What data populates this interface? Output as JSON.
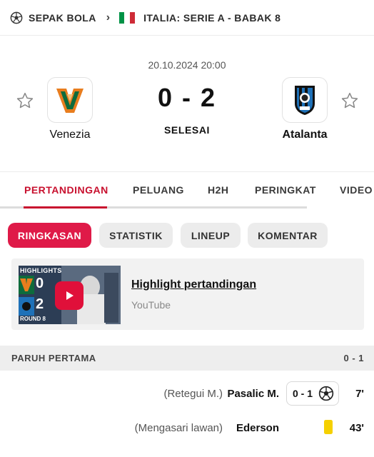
{
  "breadcrumb": {
    "sport": "SEPAK BOLA",
    "competition": "ITALIA: SERIE A - BABAK 8",
    "flag_colors": [
      "#009246",
      "#ffffff",
      "#ce2b37"
    ]
  },
  "match": {
    "datetime": "20.10.2024 20:00",
    "score": "0 - 2",
    "status": "SELESAI",
    "home": {
      "name": "Venezia",
      "logo_icon": "venezia-crest-icon"
    },
    "away": {
      "name": "Atalanta",
      "logo_icon": "atalanta-crest-icon"
    }
  },
  "tabs": [
    "PERTANDINGAN",
    "PELUANG",
    "H2H",
    "PERINGKAT",
    "VIDEO"
  ],
  "active_tab": "PERTANDINGAN",
  "subtabs": [
    "RINGKASAN",
    "STATISTIK",
    "LINEUP",
    "KOMENTAR"
  ],
  "active_subtab": "RINGKASAN",
  "highlight": {
    "title": "Highlight pertandingan",
    "source": "YouTube",
    "thumb_label": "HIGHLIGHTS",
    "thumb_home_score": "0",
    "thumb_away_score": "2",
    "thumb_round": "ROUND 8"
  },
  "section": {
    "title": "PARUH PERTAMA",
    "score": "0 - 1"
  },
  "events": [
    {
      "assist": "(Retegui M.)",
      "player": "Pasalic M.",
      "score": "0 - 1",
      "icon": "soccer-ball-icon",
      "minute": "7'"
    },
    {
      "assist": "(Mengasari lawan)",
      "player": "Ederson",
      "icon": "yellow-card-icon",
      "minute": "43'"
    }
  ],
  "colors": {
    "accent": "#c8102e",
    "pill_active": "#df1a48",
    "play_button": "#e0103a",
    "yellow_card": "#f5d000",
    "venezia_orange": "#e87d1e",
    "venezia_green": "#0e6b3c",
    "atalanta_blue": "#1e71b8"
  }
}
